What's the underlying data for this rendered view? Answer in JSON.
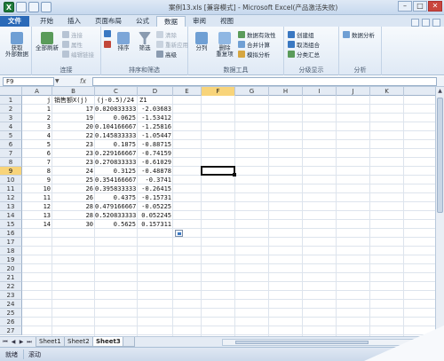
{
  "window": {
    "title": "案例13.xls [兼容模式] - Microsoft Excel(产品激活失败)",
    "min_glyph": "–",
    "max_glyph": "□",
    "close_glyph": "✕"
  },
  "tabs": [
    {
      "label": "文件"
    },
    {
      "label": "开始"
    },
    {
      "label": "插入"
    },
    {
      "label": "页面布局"
    },
    {
      "label": "公式"
    },
    {
      "label": "数据"
    },
    {
      "label": "审阅"
    },
    {
      "label": "视图"
    }
  ],
  "ribbon": {
    "get_external": "获取\n外部数据",
    "refresh_all": "全部刷新",
    "connections": "连接",
    "properties": "属性",
    "edit_links": "编辑链接",
    "group_connections": "连接",
    "sort": "排序",
    "filter": "筛选",
    "clear": "清除",
    "reapply": "重新应用",
    "advanced": "高级",
    "group_sort_filter": "排序和筛选",
    "text_to_columns": "分列",
    "remove_duplicates": "删除\n重复项",
    "data_validation": "数据有效性",
    "consolidate": "合并计算",
    "what_if": "模拟分析",
    "group_data_tools": "数据工具",
    "group_outline_btn": "创建组",
    "ungroup": "取消组合",
    "subtotal": "分类汇总",
    "group_outline": "分级显示",
    "data_analysis": "数据分析",
    "group_analysis": "分析"
  },
  "formula_bar": {
    "name_box": "F9",
    "fx": "fx",
    "value": ""
  },
  "grid": {
    "columns": [
      "A",
      "B",
      "C",
      "D",
      "E",
      "F",
      "G",
      "H",
      "I",
      "J",
      "K"
    ],
    "selected_column": "F",
    "selected_row": "9",
    "row_numbers": [
      "1",
      "2",
      "3",
      "4",
      "5",
      "6",
      "7",
      "8",
      "9",
      "10",
      "11",
      "12",
      "13",
      "14",
      "15",
      "16",
      "17",
      "18",
      "19",
      "20",
      "21",
      "22",
      "23",
      "24",
      "25",
      "26",
      "27"
    ],
    "header_row": {
      "a": "j",
      "b": "销售额X(j)",
      "c": "(j-0.5)/24",
      "d": "Z1"
    },
    "rows": [
      {
        "a": "1",
        "b": "17",
        "c": "0.020833333",
        "d": "-2.03683"
      },
      {
        "a": "2",
        "b": "19",
        "c": "0.0625",
        "d": "-1.53412"
      },
      {
        "a": "3",
        "b": "20",
        "c": "0.104166667",
        "d": "-1.25816"
      },
      {
        "a": "4",
        "b": "22",
        "c": "0.145833333",
        "d": "-1.05447"
      },
      {
        "a": "5",
        "b": "23",
        "c": "0.1875",
        "d": "-0.88715"
      },
      {
        "a": "6",
        "b": "23",
        "c": "0.229166667",
        "d": "-0.74159"
      },
      {
        "a": "7",
        "b": "23",
        "c": "0.270833333",
        "d": "-0.61029"
      },
      {
        "a": "8",
        "b": "24",
        "c": "0.3125",
        "d": "-0.48878"
      },
      {
        "a": "9",
        "b": "25",
        "c": "0.354166667",
        "d": "-0.3741"
      },
      {
        "a": "10",
        "b": "26",
        "c": "0.395833333",
        "d": "-0.26415"
      },
      {
        "a": "11",
        "b": "26",
        "c": "0.4375",
        "d": "-0.15731"
      },
      {
        "a": "12",
        "b": "28",
        "c": "0.479166667",
        "d": "-0.05225"
      },
      {
        "a": "13",
        "b": "28",
        "c": "0.520833333",
        "d": "0.052245"
      },
      {
        "a": "14",
        "b": "30",
        "c": "0.5625",
        "d": "0.157311"
      }
    ]
  },
  "sheets": [
    {
      "label": "Sheet1"
    },
    {
      "label": "Sheet2"
    },
    {
      "label": "Sheet3"
    }
  ],
  "active_sheet": "Sheet3",
  "status": {
    "mode": "就绪",
    "scroll": "滚动"
  }
}
